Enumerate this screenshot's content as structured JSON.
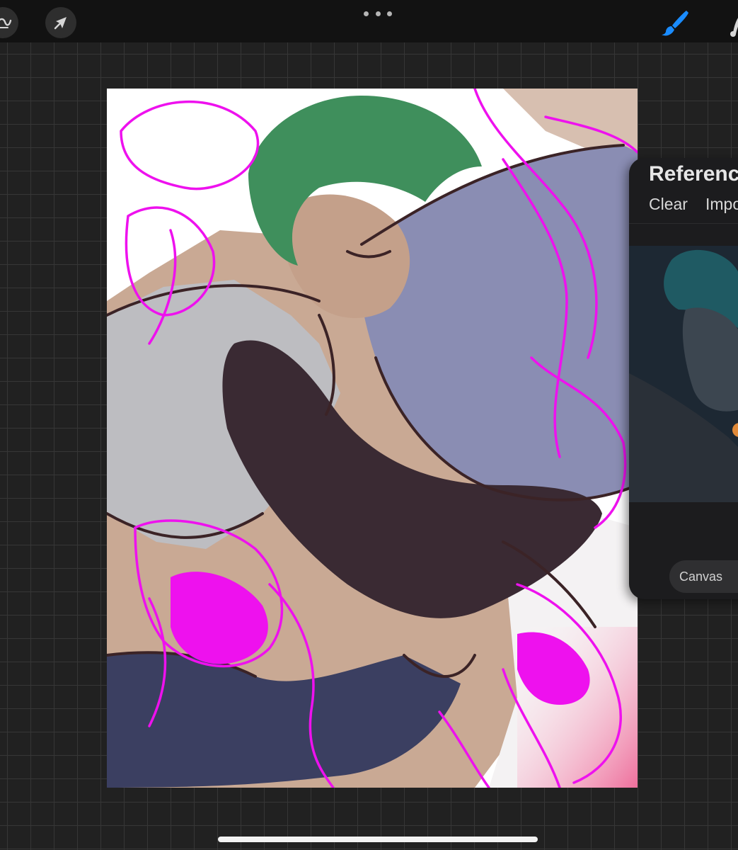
{
  "toolbar": {
    "left_tools": [
      "adjustments-icon",
      "selection-icon"
    ],
    "more_menu": "more-dots-icon",
    "right_tools": [
      "brush-icon",
      "smudge-icon"
    ],
    "active_tool": "brush",
    "active_color": "#1a8cff"
  },
  "canvas": {
    "background": "#ffffff"
  },
  "reference_panel": {
    "title": "Referenc",
    "clear_label": "Clear",
    "import_label": "Impo",
    "tab_canvas_label": "Canvas"
  }
}
